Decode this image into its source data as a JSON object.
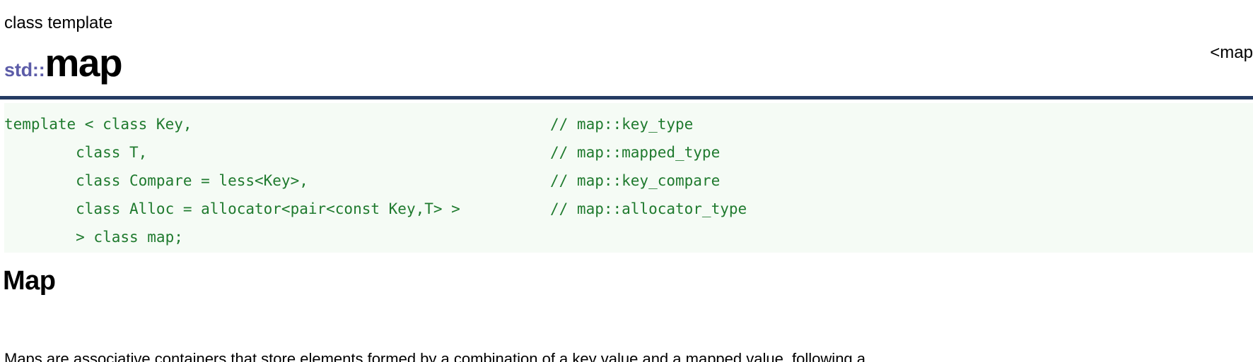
{
  "header": {
    "kind_label": "class template",
    "namespace": "std::",
    "class_name": "map",
    "include_header": "<map>",
    "rule_color": "#253b63",
    "namespace_color": "#5c5ca8"
  },
  "code_block": {
    "background_color": "#f5fbf5",
    "text_color": "#1f7a2e",
    "lines": [
      {
        "declaration": "template < class Key,",
        "comment": "// map::key_type"
      },
      {
        "declaration": "        class T,",
        "comment": "// map::mapped_type"
      },
      {
        "declaration": "        class Compare = less<Key>,",
        "comment": "// map::key_compare"
      },
      {
        "declaration": "        class Alloc = allocator<pair<const Key,T> >",
        "comment": "// map::allocator_type"
      },
      {
        "declaration": "        > class map;",
        "comment": ""
      }
    ]
  },
  "sections": {
    "map_heading": "Map",
    "map_paragraph": "Maps are associative containers that store elements formed by a combination of a key value and a mapped value, following a"
  }
}
